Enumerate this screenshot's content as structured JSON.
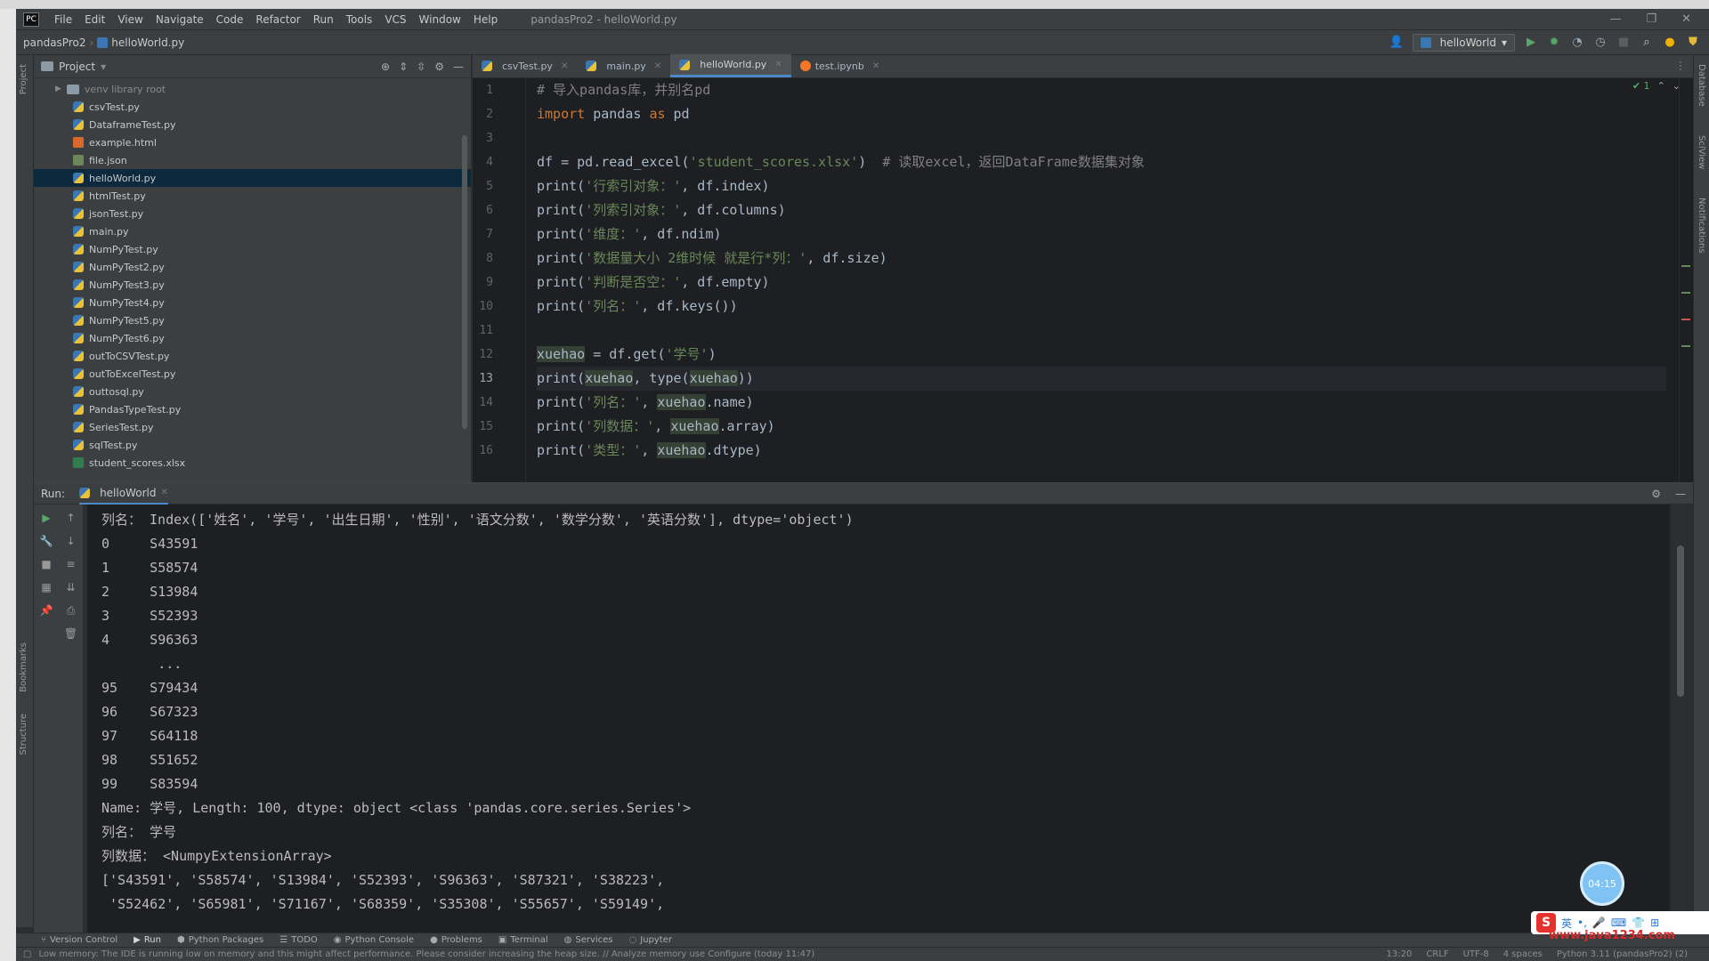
{
  "window": {
    "title": "pandasPro2 - helloWorld.py",
    "menu": [
      "File",
      "Edit",
      "View",
      "Navigate",
      "Code",
      "Refactor",
      "Run",
      "Tools",
      "VCS",
      "Window",
      "Help"
    ],
    "controls": [
      "—",
      "❐",
      "✕"
    ]
  },
  "navbar": {
    "project": "pandasPro2",
    "file": "helloWorld.py",
    "run_config": "helloWorld"
  },
  "project_panel": {
    "title": "Project",
    "root": "venv  library root",
    "files": [
      {
        "name": "csvTest.py",
        "type": "py"
      },
      {
        "name": "DataframeTest.py",
        "type": "py"
      },
      {
        "name": "example.html",
        "type": "html"
      },
      {
        "name": "file.json",
        "type": "json"
      },
      {
        "name": "helloWorld.py",
        "type": "py",
        "selected": true
      },
      {
        "name": "htmlTest.py",
        "type": "py"
      },
      {
        "name": "jsonTest.py",
        "type": "py"
      },
      {
        "name": "main.py",
        "type": "py"
      },
      {
        "name": "NumPyTest.py",
        "type": "py"
      },
      {
        "name": "NumPyTest2.py",
        "type": "py"
      },
      {
        "name": "NumPyTest3.py",
        "type": "py"
      },
      {
        "name": "NumPyTest4.py",
        "type": "py"
      },
      {
        "name": "NumPyTest5.py",
        "type": "py"
      },
      {
        "name": "NumPyTest6.py",
        "type": "py"
      },
      {
        "name": "outToCSVTest.py",
        "type": "py"
      },
      {
        "name": "outToExcelTest.py",
        "type": "py"
      },
      {
        "name": "outtosql.py",
        "type": "py"
      },
      {
        "name": "PandasTypeTest.py",
        "type": "py"
      },
      {
        "name": "SeriesTest.py",
        "type": "py"
      },
      {
        "name": "sqlTest.py",
        "type": "py"
      },
      {
        "name": "student_scores.xlsx",
        "type": "xlsx"
      }
    ]
  },
  "editor": {
    "tabs": [
      {
        "label": "csvTest.py",
        "active": false
      },
      {
        "label": "main.py",
        "active": false
      },
      {
        "label": "helloWorld.py",
        "active": true
      },
      {
        "label": "test.ipynb",
        "active": false
      }
    ],
    "inspection": "✔ 1",
    "current_line": 13,
    "lines": [
      {
        "n": "1",
        "parts": [
          {
            "c": "cm",
            "t": "# 导入pandas库，并别名pd"
          }
        ]
      },
      {
        "n": "2",
        "parts": [
          {
            "c": "kw",
            "t": "import"
          },
          {
            "c": "",
            "t": " pandas "
          },
          {
            "c": "kw",
            "t": "as"
          },
          {
            "c": "",
            "t": " pd"
          }
        ]
      },
      {
        "n": "3",
        "parts": []
      },
      {
        "n": "4",
        "parts": [
          {
            "c": "",
            "t": "df = pd.read_excel("
          },
          {
            "c": "st",
            "t": "'student_scores.xlsx'"
          },
          {
            "c": "",
            "t": ")  "
          },
          {
            "c": "cm",
            "t": "# 读取excel，返回DataFrame数据集对象"
          }
        ]
      },
      {
        "n": "5",
        "parts": [
          {
            "c": "",
            "t": "print("
          },
          {
            "c": "st",
            "t": "'行索引对象：'"
          },
          {
            "c": "",
            "t": ", df.index)"
          }
        ]
      },
      {
        "n": "6",
        "parts": [
          {
            "c": "",
            "t": "print("
          },
          {
            "c": "st",
            "t": "'列索引对象：'"
          },
          {
            "c": "",
            "t": ", df.columns)"
          }
        ]
      },
      {
        "n": "7",
        "parts": [
          {
            "c": "",
            "t": "print("
          },
          {
            "c": "st",
            "t": "'维度：'"
          },
          {
            "c": "",
            "t": ", df.ndim)"
          }
        ]
      },
      {
        "n": "8",
        "parts": [
          {
            "c": "",
            "t": "print("
          },
          {
            "c": "st",
            "t": "'数据量大小 2维时候 就是行*列：'"
          },
          {
            "c": "",
            "t": ", df.size)"
          }
        ]
      },
      {
        "n": "9",
        "parts": [
          {
            "c": "",
            "t": "print("
          },
          {
            "c": "st",
            "t": "'判断是否空：'"
          },
          {
            "c": "",
            "t": ", df.empty)"
          }
        ]
      },
      {
        "n": "10",
        "parts": [
          {
            "c": "",
            "t": "print("
          },
          {
            "c": "st",
            "t": "'列名：'"
          },
          {
            "c": "",
            "t": ", df.keys())"
          }
        ]
      },
      {
        "n": "11",
        "parts": []
      },
      {
        "n": "12",
        "parts": [
          {
            "c": "vr",
            "t": "xuehao"
          },
          {
            "c": "",
            "t": " = df.get("
          },
          {
            "c": "st",
            "t": "'学号'"
          },
          {
            "c": "",
            "t": ")"
          }
        ]
      },
      {
        "n": "13",
        "parts": [
          {
            "c": "",
            "t": "print("
          },
          {
            "c": "vr",
            "t": "xuehao"
          },
          {
            "c": "",
            "t": ", type("
          },
          {
            "c": "vr",
            "t": "xuehao"
          },
          {
            "c": "",
            "t": "))"
          }
        ]
      },
      {
        "n": "14",
        "parts": [
          {
            "c": "",
            "t": "print("
          },
          {
            "c": "st",
            "t": "'列名：'"
          },
          {
            "c": "",
            "t": ", "
          },
          {
            "c": "vr",
            "t": "xuehao"
          },
          {
            "c": "",
            "t": ".name)"
          }
        ]
      },
      {
        "n": "15",
        "parts": [
          {
            "c": "",
            "t": "print("
          },
          {
            "c": "st",
            "t": "'列数据：'"
          },
          {
            "c": "",
            "t": ", "
          },
          {
            "c": "vr",
            "t": "xuehao"
          },
          {
            "c": "",
            "t": ".array)"
          }
        ]
      },
      {
        "n": "16",
        "parts": [
          {
            "c": "",
            "t": "print("
          },
          {
            "c": "st",
            "t": "'类型：'"
          },
          {
            "c": "",
            "t": ", "
          },
          {
            "c": "vr",
            "t": "xuehao"
          },
          {
            "c": "",
            "t": ".dtype)"
          }
        ]
      }
    ]
  },
  "run_panel": {
    "title": "Run:",
    "tab": "helloWorld",
    "output": [
      "列名： Index(['姓名', '学号', '出生日期', '性别', '语文分数', '数学分数', '英语分数'], dtype='object')",
      "0     S43591",
      "1     S58574",
      "2     S13984",
      "3     S52393",
      "4     S96363",
      "       ...",
      "95    S79434",
      "96    S67323",
      "97    S64118",
      "98    S51652",
      "99    S83594",
      "Name: 学号, Length: 100, dtype: object <class 'pandas.core.series.Series'>",
      "列名： 学号",
      "列数据： <NumpyExtensionArray>",
      "['S43591', 'S58574', 'S13984', 'S52393', 'S96363', 'S87321', 'S38223',",
      " 'S52462', 'S65981', 'S71167', 'S68359', 'S35308', 'S55657', 'S59149',"
    ]
  },
  "tool_tabs": [
    "Version Control",
    "Run",
    "Python Packages",
    "TODO",
    "Python Console",
    "Problems",
    "Terminal",
    "Services",
    "Jupyter"
  ],
  "status_bar": {
    "message": "Low memory: The IDE is running low on memory and this might affect performance. Please consider increasing the heap size. // Analyze memory use   Configure (today 11:47)",
    "position": "13:20",
    "line_sep": "CRLF",
    "encoding": "UTF-8",
    "indent": "4 spaces",
    "interpreter": "Python 3.11 (pandasPro2) (2)"
  },
  "overlay": {
    "bubble": "04:15",
    "ime_logo": "S",
    "ime_label": "英",
    "watermark": "www.java1234.com"
  },
  "colors": {
    "accent": "#4a88c7",
    "keyword": "#cc7832",
    "string": "#6a8759",
    "comment": "#808080"
  }
}
